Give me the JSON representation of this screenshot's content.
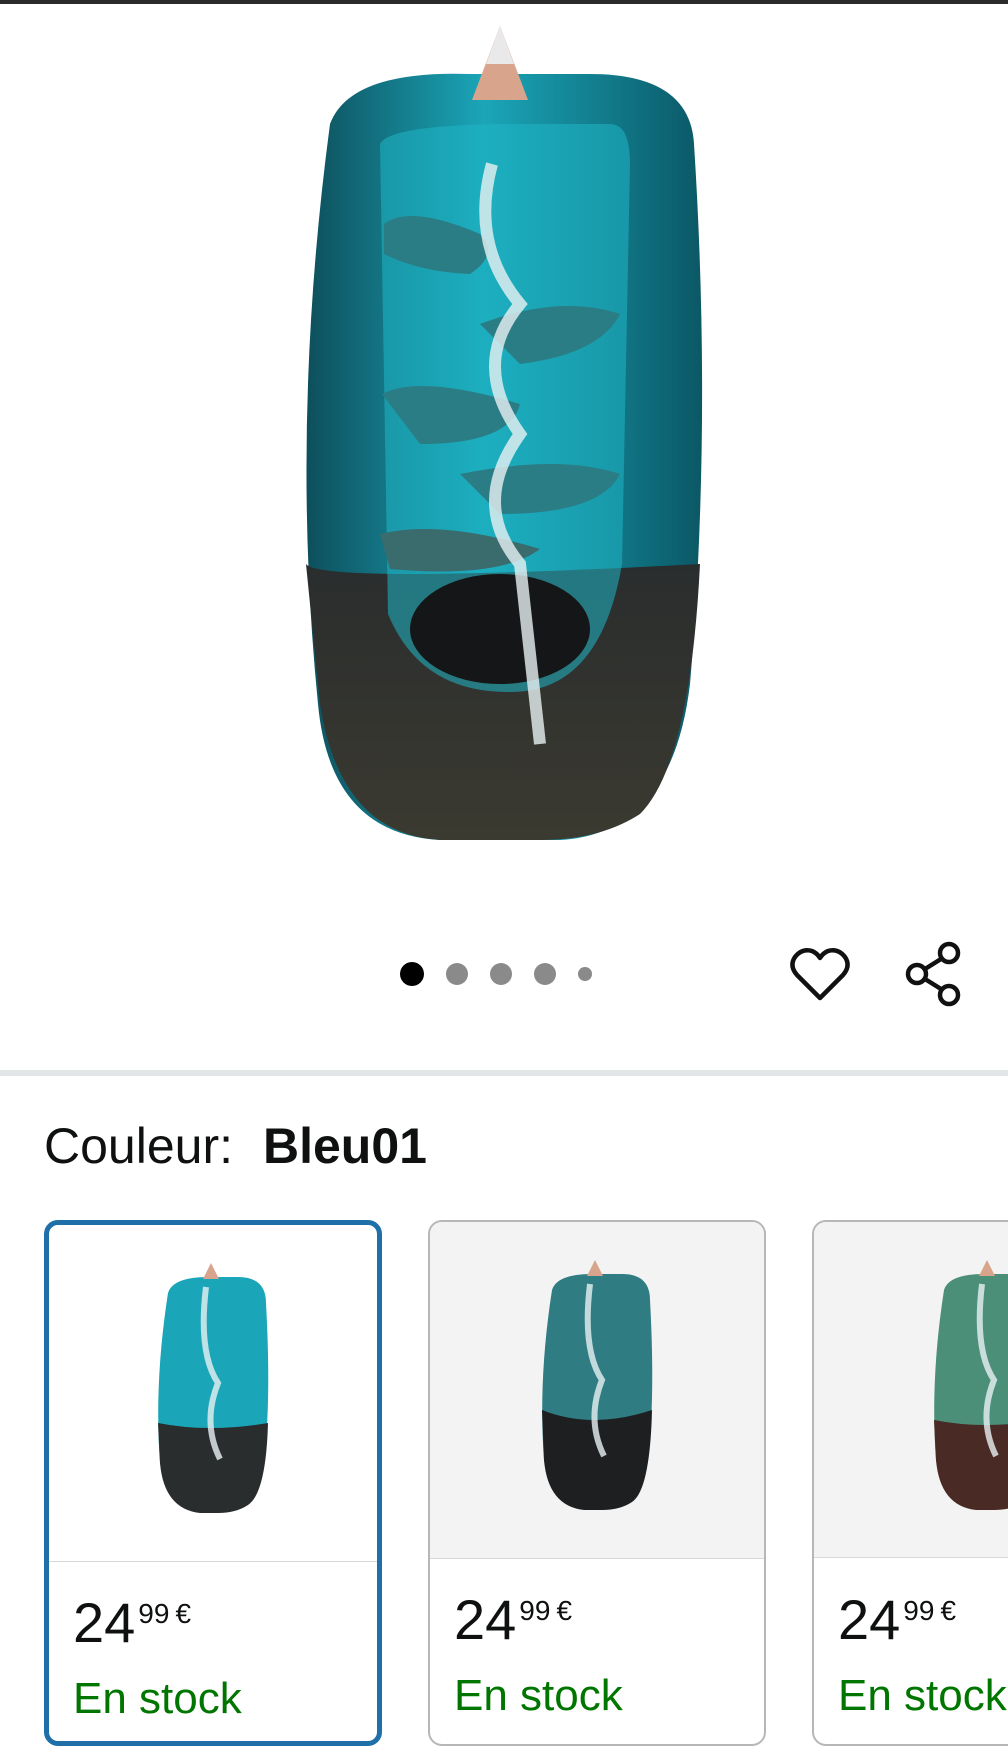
{
  "product": {
    "image_label": "incense-waterfall-burner",
    "carousel": {
      "count": 5,
      "active_index": 0
    }
  },
  "icons": {
    "wishlist": "heart-outline-icon",
    "share": "share-icon"
  },
  "variation": {
    "label": "Couleur:",
    "selected": "Bleu01",
    "options": [
      {
        "price_whole": "24",
        "price_fraction": "99",
        "currency": "€",
        "availability": "En stock",
        "glaze": "#1aa6b8",
        "selected": true
      },
      {
        "price_whole": "24",
        "price_fraction": "99",
        "currency": "€",
        "availability": "En stock",
        "glaze": "#2f7d83",
        "selected": false
      },
      {
        "price_whole": "24",
        "price_fraction": "99",
        "currency": "€",
        "availability": "En stock",
        "glaze": "#4c8f78",
        "selected": false
      }
    ]
  },
  "colors": {
    "accent": "#1f6fa8",
    "in_stock": "#007600"
  }
}
